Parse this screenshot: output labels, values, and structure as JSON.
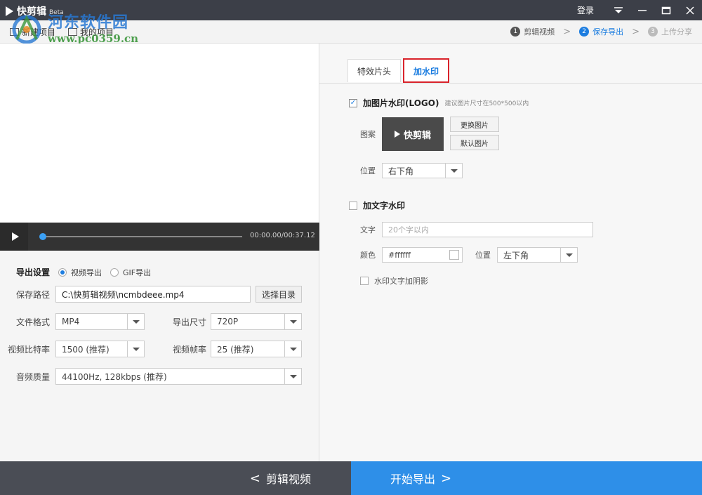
{
  "titlebar": {
    "app_name": "快剪辑",
    "beta": "Beta",
    "login": "登录"
  },
  "nav": {
    "items": [
      "新建项目",
      "我的项目"
    ]
  },
  "steps": [
    {
      "num": "1",
      "label": "剪辑视频"
    },
    {
      "num": "2",
      "label": "保存导出"
    },
    {
      "num": "3",
      "label": "上传分享"
    }
  ],
  "watermark": {
    "title": "河东软件园",
    "url": "www.pc0359.cn"
  },
  "player": {
    "time": "00:00.00/00:37.12",
    "progress": 0
  },
  "export": {
    "title": "导出设置",
    "radio_video": "视频导出",
    "radio_gif": "GIF导出",
    "save_path_label": "保存路径",
    "save_path_value": "C:\\快剪辑视频\\ncmbdeee.mp4",
    "choose_dir_button": "选择目录",
    "format_label": "文件格式",
    "format_value": "MP4",
    "size_label": "导出尺寸",
    "size_value": "720P",
    "bitrate_label": "视频比特率",
    "bitrate_value": "1500 (推荐)",
    "fps_label": "视频帧率",
    "fps_value": "25 (推荐)",
    "audio_label": "音频质量",
    "audio_value": "44100Hz, 128kbps (推荐)"
  },
  "right": {
    "tabs": [
      "特效片头",
      "加水印"
    ],
    "image_wm_label": "加图片水印(LOGO)",
    "image_wm_hint": "建议图片尺寸在500*500以内",
    "pattern_label": "图案",
    "logo_text": "快剪辑",
    "replace_button": "更换图片",
    "default_button": "默认图片",
    "position_label": "位置",
    "position_value": "右下角",
    "text_wm_label": "加文字水印",
    "text_label": "文字",
    "text_placeholder": "20个字以内",
    "color_label": "颜色",
    "color_value": "#ffffff",
    "text_position_label": "位置",
    "text_position_value": "左下角",
    "shadow_label": "水印文字加阴影"
  },
  "footer": {
    "back_label": "剪辑视频",
    "export_label": "开始导出"
  },
  "colors": {
    "accent": "#1c7de0",
    "footer_blue": "#2e8fe8",
    "highlight_red": "#d9232b"
  }
}
